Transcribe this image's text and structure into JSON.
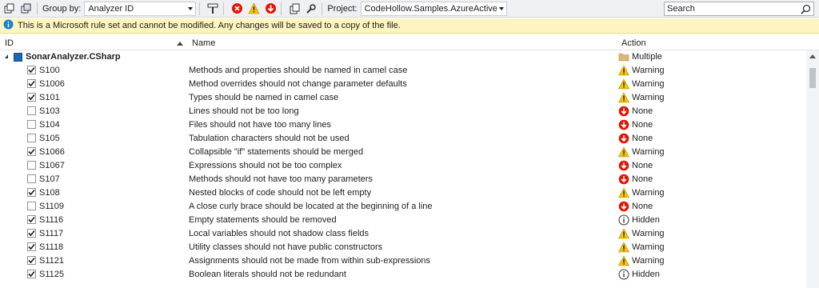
{
  "toolbar": {
    "group_by_label": "Group by:",
    "group_by_value": "Analyzer ID",
    "project_label": "Project:",
    "project_value": "CodeHollow.Samples.AzureActive",
    "search_placeholder": "Search"
  },
  "infobar": {
    "message": "This is a Microsoft rule set and cannot be modified. Any changes will be saved to a copy of the file."
  },
  "columns": {
    "id": "ID",
    "name": "Name",
    "action": "Action"
  },
  "group": {
    "name": "SonarAnalyzer.CSharp",
    "action": "Multiple",
    "action_icon": "folder-icon"
  },
  "rules": [
    {
      "id": "S100",
      "name": "Methods and properties should be named in camel case",
      "checked": true,
      "action": "Warning",
      "icon": "warning"
    },
    {
      "id": "S1006",
      "name": "Method overrides should not change parameter defaults",
      "checked": true,
      "action": "Warning",
      "icon": "warning"
    },
    {
      "id": "S101",
      "name": "Types should be named in camel case",
      "checked": true,
      "action": "Warning",
      "icon": "warning"
    },
    {
      "id": "S103",
      "name": "Lines should not be too long",
      "checked": false,
      "action": "None",
      "icon": "none"
    },
    {
      "id": "S104",
      "name": "Files should not have too many lines",
      "checked": false,
      "action": "None",
      "icon": "none"
    },
    {
      "id": "S105",
      "name": "Tabulation characters should not be used",
      "checked": false,
      "action": "None",
      "icon": "none"
    },
    {
      "id": "S1066",
      "name": "Collapsible \"if\" statements should be merged",
      "checked": true,
      "action": "Warning",
      "icon": "warning"
    },
    {
      "id": "S1067",
      "name": "Expressions should not be too complex",
      "checked": false,
      "action": "None",
      "icon": "none"
    },
    {
      "id": "S107",
      "name": "Methods should not have too many parameters",
      "checked": false,
      "action": "None",
      "icon": "none"
    },
    {
      "id": "S108",
      "name": "Nested blocks of code should not be left empty",
      "checked": true,
      "action": "Warning",
      "icon": "warning"
    },
    {
      "id": "S1109",
      "name": "A close curly brace should be located at the beginning of a line",
      "checked": false,
      "action": "None",
      "icon": "none"
    },
    {
      "id": "S1116",
      "name": "Empty statements should be removed",
      "checked": true,
      "action": "Hidden",
      "icon": "hidden"
    },
    {
      "id": "S1117",
      "name": "Local variables should not shadow class fields",
      "checked": true,
      "action": "Warning",
      "icon": "warning"
    },
    {
      "id": "S1118",
      "name": "Utility classes should not have public constructors",
      "checked": true,
      "action": "Warning",
      "icon": "warning"
    },
    {
      "id": "S1121",
      "name": "Assignments should not be made from within sub-expressions",
      "checked": true,
      "action": "Warning",
      "icon": "warning"
    },
    {
      "id": "S1125",
      "name": "Boolean literals should not be redundant",
      "checked": true,
      "action": "Hidden",
      "icon": "hidden"
    }
  ],
  "colors": {
    "warning": "#f5c400",
    "error": "#e51400",
    "info": "#1d80d6",
    "folder": "#dcb67a"
  }
}
